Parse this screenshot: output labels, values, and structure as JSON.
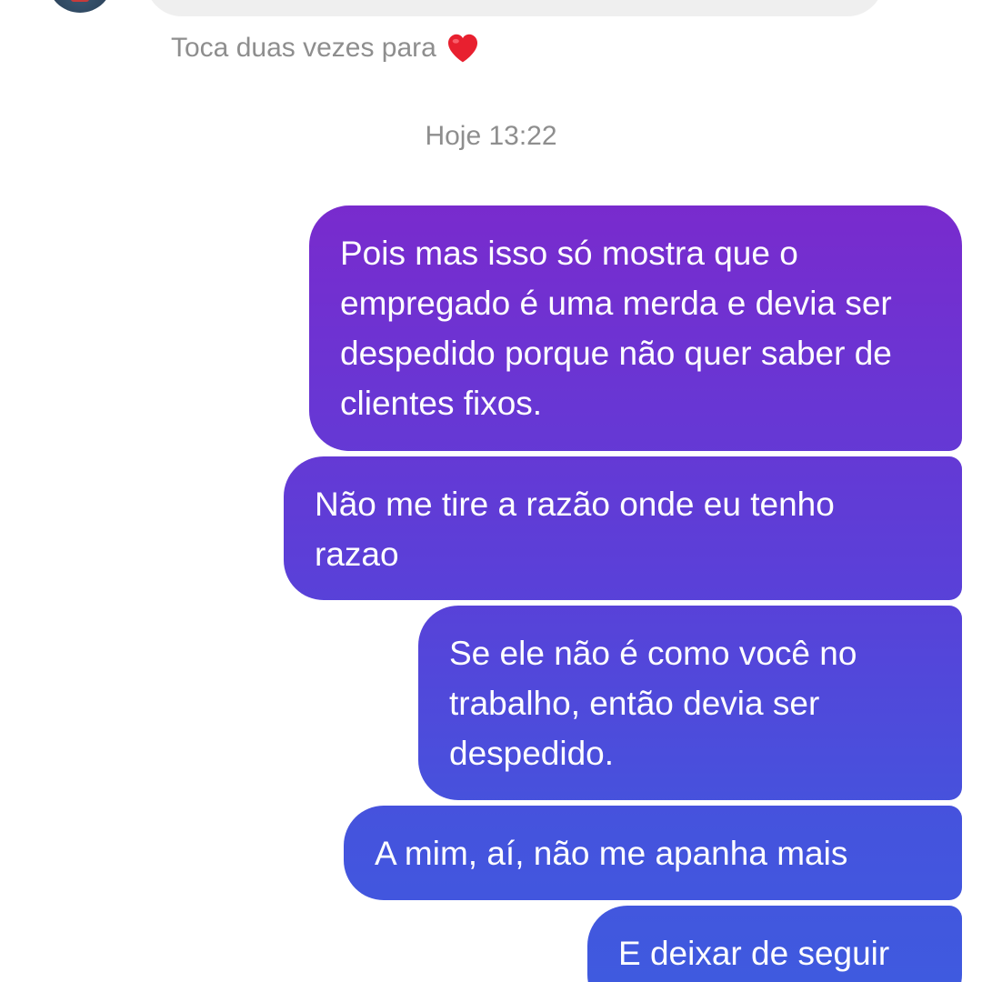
{
  "previous_message": {
    "double_tap_hint": "Toca duas vezes para",
    "hint_icon": "heart-icon",
    "hint_icon_color": "#e8202f"
  },
  "timestamp": "Hoje 13:22",
  "colors": {
    "outgoing_gradient_top": "#8a1fc6",
    "outgoing_gradient_bottom": "#3f5adf",
    "incoming_bubble": "#efefef",
    "meta_text": "#8e8e8e"
  },
  "messages": [
    {
      "direction": "outgoing",
      "text": "Pois mas isso só mostra que o empregado é uma merda e devia ser despedido porque não quer saber de clientes fixos."
    },
    {
      "direction": "outgoing",
      "text": "Não me tire a razão onde eu tenho razao"
    },
    {
      "direction": "outgoing",
      "text": "Se ele não é como você no trabalho, então devia ser despedido."
    },
    {
      "direction": "outgoing",
      "text": "A mim, aí, não me apanha mais"
    },
    {
      "direction": "outgoing",
      "text": "E deixar de seguir"
    }
  ]
}
